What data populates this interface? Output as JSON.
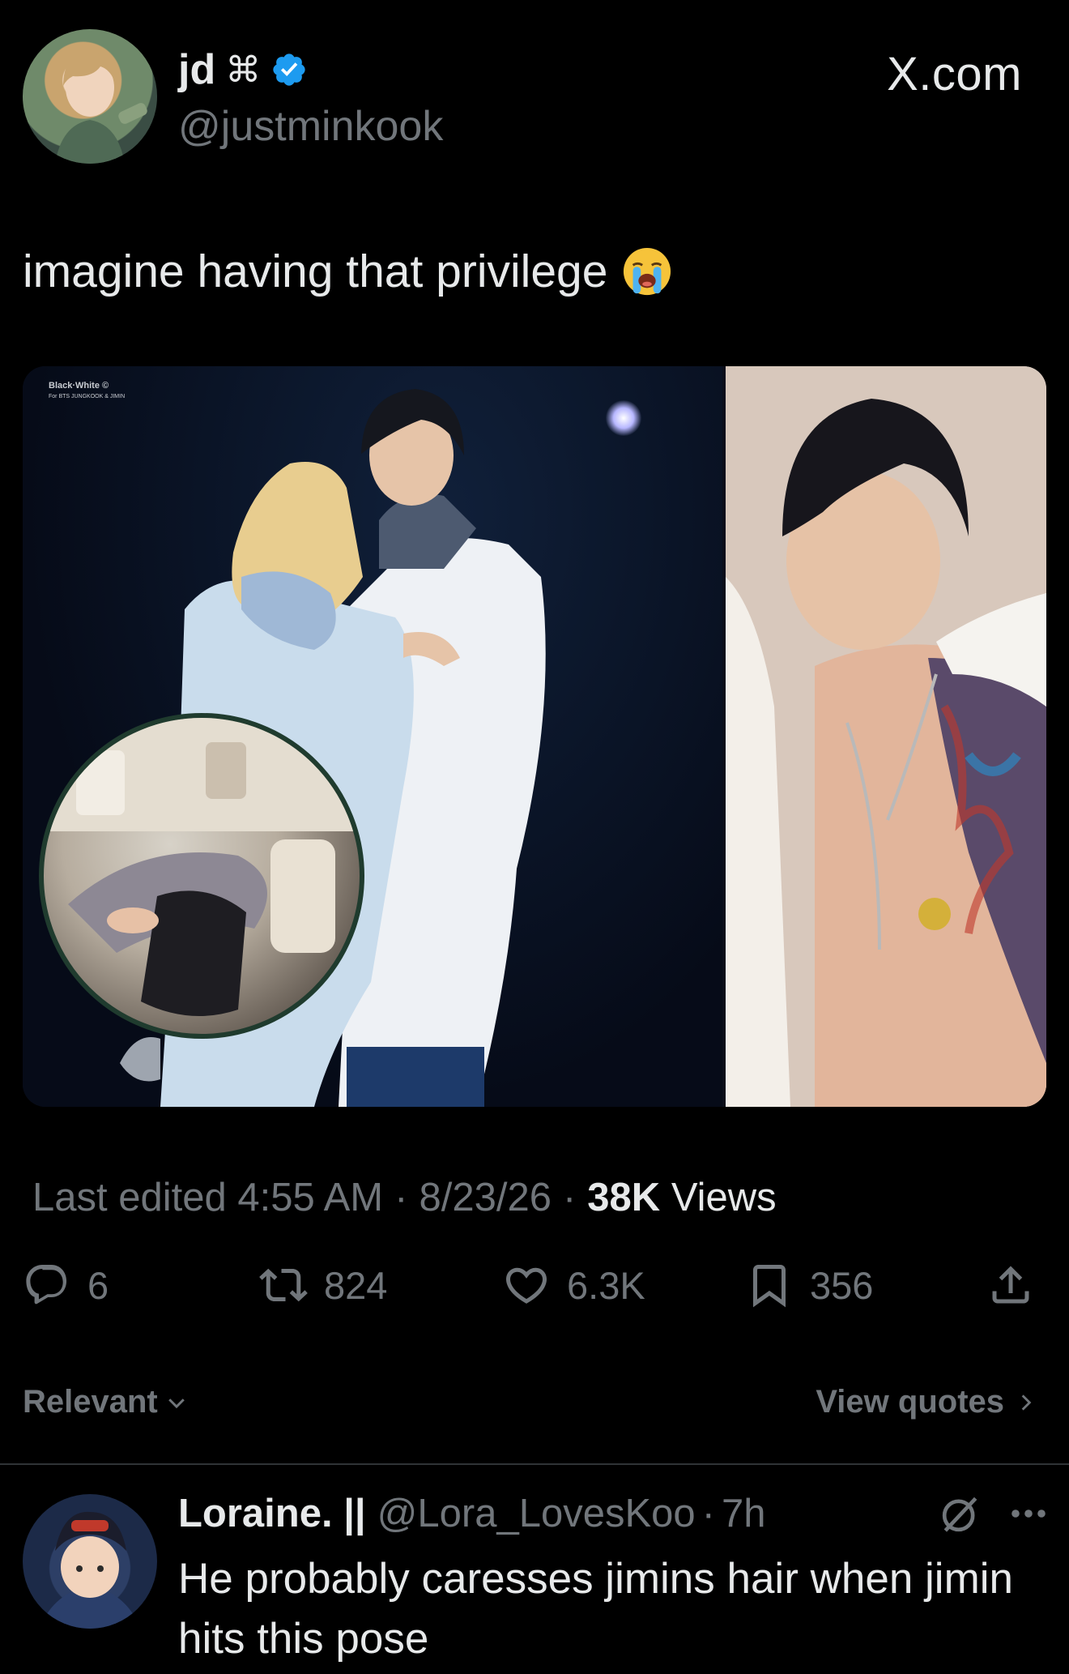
{
  "author": {
    "display_name": "jd",
    "name_glyph": "⌘",
    "handle": "@justminkook",
    "verified": true,
    "avatar_icon": "avatar-icon"
  },
  "site_label": "X.com",
  "post": {
    "text": "imagine having that privilege",
    "emoji": "loudly-crying-face-icon"
  },
  "media": {
    "watermark_line1": "Black·White ©",
    "watermark_line2": "For BTS JUNGKOOK & JIMIN",
    "left_photo": "concert-photo",
    "right_photo": "shirtless-photo",
    "inset": "airplane-inset-photo"
  },
  "meta": {
    "edited_label": "Last edited 4:55 AM",
    "sep1": "·",
    "date": "8/23/26",
    "sep2": "·",
    "views_count": "38K",
    "views_label": "Views"
  },
  "actions": {
    "replies": "6",
    "reposts": "824",
    "likes": "6.3K",
    "bookmarks": "356"
  },
  "sort": {
    "relevant_label": "Relevant",
    "view_quotes_label": "View quotes"
  },
  "reply": {
    "display_name": "Loraine. ||",
    "handle": "@Lora_LovesKoo",
    "dot": "·",
    "time": "7h",
    "text": "He probably caresses jimins hair when jimin hits this pose"
  },
  "colors": {
    "background": "#000000",
    "text_primary": "#e7e9ea",
    "text_secondary": "#71767b",
    "verified_blue": "#1d9bf0",
    "divider": "#2f3336"
  }
}
